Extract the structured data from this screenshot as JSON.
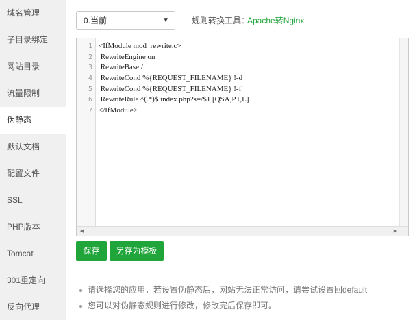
{
  "sidebar": {
    "items": [
      {
        "label": "域名管理",
        "active": false
      },
      {
        "label": "子目录绑定",
        "active": false
      },
      {
        "label": "网站目录",
        "active": false
      },
      {
        "label": "流量限制",
        "active": false
      },
      {
        "label": "伪静态",
        "active": true
      },
      {
        "label": "默认文档",
        "active": false
      },
      {
        "label": "配置文件",
        "active": false
      },
      {
        "label": "SSL",
        "active": false
      },
      {
        "label": "PHP版本",
        "active": false
      },
      {
        "label": "Tomcat",
        "active": false
      },
      {
        "label": "301重定向",
        "active": false
      },
      {
        "label": "反向代理",
        "active": false
      }
    ]
  },
  "toolbar": {
    "select_value": "0.当前",
    "caret_icon": "▼",
    "tool_label": "规则转换工具：",
    "tool_link": "Apache转Nginx"
  },
  "editor": {
    "line_numbers": [
      "1",
      "2",
      "3",
      "4",
      "5",
      "6",
      "7"
    ],
    "lines": [
      "<IfModule mod_rewrite.c>",
      " RewriteEngine on",
      " RewriteBase /",
      " RewriteCond %{REQUEST_FILENAME} !-d",
      " RewriteCond %{REQUEST_FILENAME} !-f",
      " RewriteRule ^(.*)$ index.php?s=/$1 [QSA,PT,L]",
      "</IfModule>"
    ],
    "scroll_left_icon": "◀",
    "scroll_right_icon": "▶"
  },
  "actions": {
    "save_label": "保存",
    "save_template_label": "另存为模板"
  },
  "tips": [
    "请选择您的应用，若设置伪静态后，网站无法正常访问，请尝试设置回default",
    "您可以对伪静态规则进行修改，修改完后保存即可。"
  ],
  "colors": {
    "accent": "#20a53a",
    "sidebar_bg": "#f0f0f0"
  }
}
